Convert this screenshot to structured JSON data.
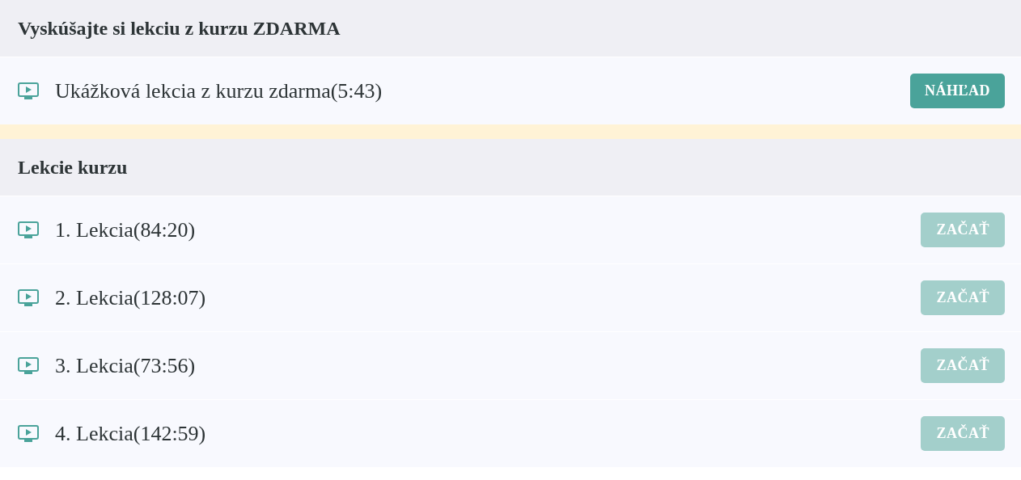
{
  "sections": [
    {
      "title": "Vyskúšajte si lekciu z kurzu ZDARMA",
      "lessons": [
        {
          "title": "Ukážková lekcia z kurzu zdarma(5:43)",
          "button": "NÁHĽAD",
          "disabled": false
        }
      ]
    },
    {
      "title": "Lekcie kurzu",
      "lessons": [
        {
          "title": "1. Lekcia(84:20)",
          "button": "ZAČAŤ",
          "disabled": true
        },
        {
          "title": "2. Lekcia(128:07)",
          "button": "ZAČAŤ",
          "disabled": true
        },
        {
          "title": "3. Lekcia(73:56)",
          "button": "ZAČAŤ",
          "disabled": true
        },
        {
          "title": "4. Lekcia(142:59)",
          "button": "ZAČAŤ",
          "disabled": true
        }
      ]
    }
  ]
}
